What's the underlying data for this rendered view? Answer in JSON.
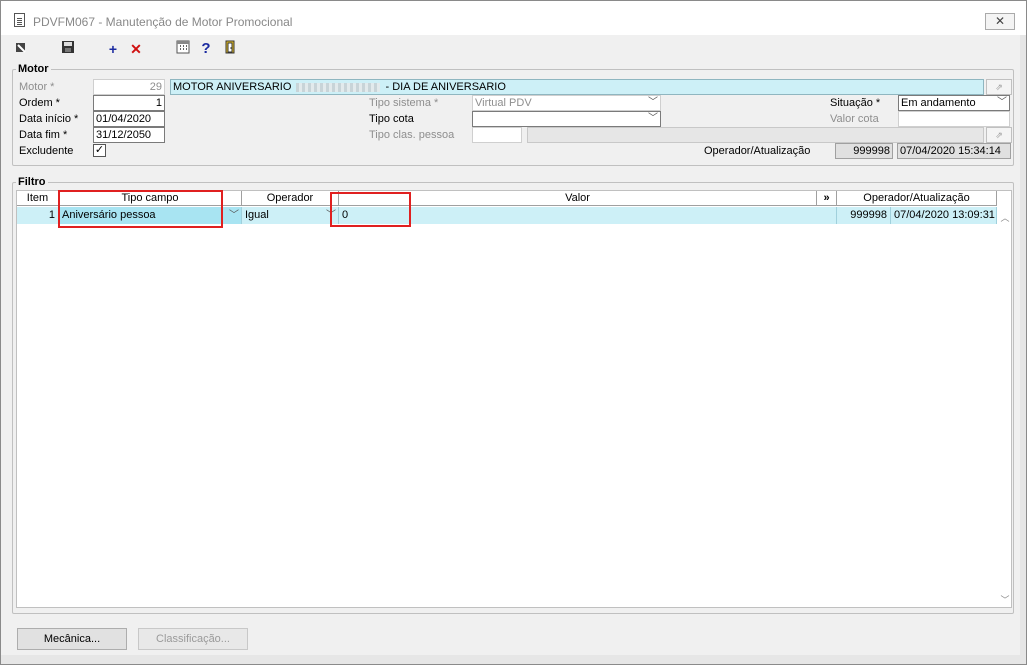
{
  "window": {
    "title": "PDVFM067 - Manutenção de Motor Promocional",
    "close_label": "✕"
  },
  "toolbar": {
    "icons": [
      "pointer-icon",
      "save-icon",
      "add-icon",
      "delete-icon",
      "calculator-icon",
      "help-icon",
      "exit-icon"
    ]
  },
  "motor": {
    "group_label": "Motor",
    "motor_label": "Motor *",
    "motor_value": "29",
    "motor_desc_prefix": "MOTOR ANIVERSARIO",
    "motor_desc_suffix": "- DIA DE ANIVERSARIO",
    "ordem_label": "Ordem *",
    "ordem_value": "1",
    "data_inicio_label": "Data início *",
    "data_inicio_value": "01/04/2020",
    "data_fim_label": "Data fim *",
    "data_fim_value": "31/12/2050",
    "excludente_label": "Excludente",
    "excludente_checked": "✓",
    "tipo_sistema_label": "Tipo sistema *",
    "tipo_sistema_value": "Virtual PDV",
    "tipo_cota_label": "Tipo cota",
    "tipo_cota_value": "",
    "tipo_clas_label": "Tipo clas. pessoa",
    "situacao_label": "Situação *",
    "situacao_value": "Em andamento",
    "valor_cota_label": "Valor cota",
    "operador_label": "Operador/Atualização",
    "operador_value": "999998",
    "atualizacao_value": "07/04/2020 15:34:14"
  },
  "filtro": {
    "group_label": "Filtro",
    "columns": {
      "item": "Item",
      "tipo_campo": "Tipo campo",
      "operador": "Operador",
      "valor": "Valor",
      "more": "»",
      "operador_atualizacao": "Operador/Atualização"
    },
    "rows": [
      {
        "item": "1",
        "tipo_campo": "Aniversário pessoa",
        "operador": "Igual",
        "valor": "0",
        "operador_id": "999998",
        "atualizacao": "07/04/2020 13:09:31"
      }
    ]
  },
  "buttons": {
    "mecanica": "Mecânica...",
    "classificacao": "Classificação..."
  }
}
